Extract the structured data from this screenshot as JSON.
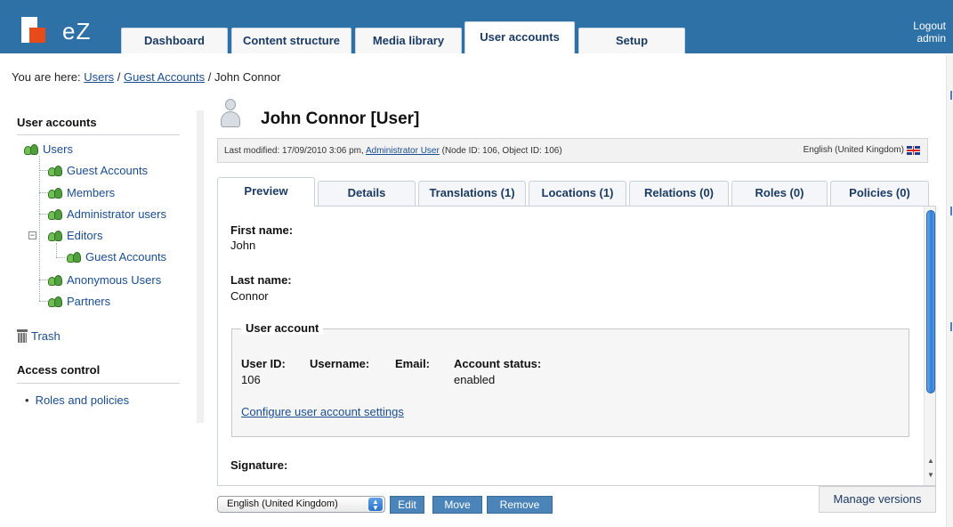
{
  "app": {
    "logo_text": "eZ",
    "logout_label": "Logout",
    "username": "admin"
  },
  "tabs": [
    {
      "label": "Dashboard"
    },
    {
      "label": "Content structure"
    },
    {
      "label": "Media library"
    },
    {
      "label": "User accounts",
      "active": true
    },
    {
      "label": "Setup"
    }
  ],
  "breadcrumb": {
    "prefix": "You are here:",
    "items": [
      "Users",
      "Guest Accounts"
    ],
    "current": "John Connor",
    "separator": "/"
  },
  "sidebar": {
    "user_accounts_heading": "User accounts",
    "tree": [
      {
        "label": "Users"
      },
      {
        "label": "Guest Accounts"
      },
      {
        "label": "Members"
      },
      {
        "label": "Administrator users"
      },
      {
        "label": "Editors"
      },
      {
        "label": "Guest Accounts"
      },
      {
        "label": "Anonymous Users"
      },
      {
        "label": "Partners"
      }
    ],
    "trash_label": "Trash",
    "access_control_heading": "Access control",
    "roles_link": "Roles and policies"
  },
  "main": {
    "title": "John Connor [User]",
    "meta": {
      "last_modified_prefix": "Last modified: 17/09/2010 3:06 pm,",
      "modifier": "Administrator User",
      "ids": "(Node ID: 106, Object ID: 106)",
      "language": "English (United Kingdom)"
    },
    "tabs": [
      {
        "label": "Preview",
        "active": true
      },
      {
        "label": "Details"
      },
      {
        "label": "Translations (1)"
      },
      {
        "label": "Locations (1)"
      },
      {
        "label": "Relations (0)"
      },
      {
        "label": "Roles (0)"
      },
      {
        "label": "Policies (0)"
      }
    ],
    "fields": {
      "first_name_label": "First name:",
      "first_name_value": "John",
      "last_name_label": "Last name:",
      "last_name_value": "Connor",
      "signature_label": "Signature:"
    },
    "user_account": {
      "legend": "User account",
      "user_id_label": "User ID:",
      "user_id_value": "106",
      "username_label": "Username:",
      "username_value": "",
      "email_label": "Email:",
      "email_value": "",
      "status_label": "Account status:",
      "status_value": "enabled",
      "configure_link": "Configure user account settings"
    }
  },
  "bottom": {
    "language_select": "English (United Kingdom)",
    "edit_label": "Edit",
    "move_label": "Move",
    "remove_label": "Remove",
    "manage_versions_label": "Manage versions"
  },
  "colors": {
    "topbar": "#2e71a7",
    "link": "#1a4d8f",
    "logo_red": "#e84a1a",
    "button": "#4a84b8"
  }
}
